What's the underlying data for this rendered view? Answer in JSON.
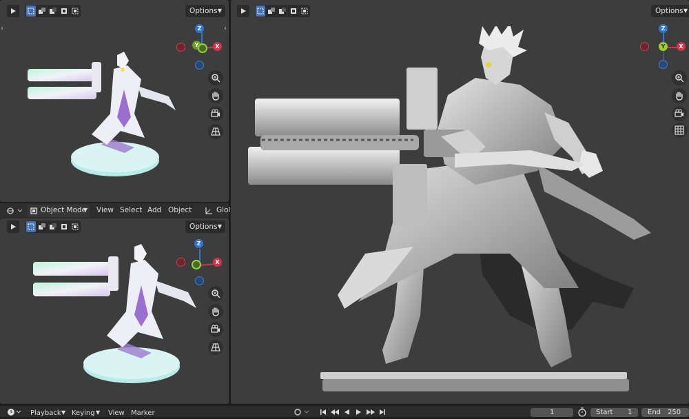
{
  "colors": {
    "viewport_bg": "#3d3d3d",
    "header_button_bg": "#2b2b2b",
    "selected_blue": "#4772b3",
    "axis_x": "#d7344b",
    "axis_y": "#6aa01c",
    "axis_z": "#2e75d3"
  },
  "viewports": {
    "top_left": {
      "options_label": "Options"
    },
    "bottom_left": {
      "options_label": "Options"
    },
    "main": {
      "options_label": "Options"
    }
  },
  "gizmo": {
    "x_label": "X",
    "y_label": "Y",
    "z_label": "Z"
  },
  "icons": {
    "tool": "select-cursor-icon",
    "select_modes": [
      "select-box-icon",
      "select-extend-icon",
      "select-subtract-icon",
      "select-invert-icon",
      "select-intersect-icon"
    ],
    "nav": [
      "zoom-icon",
      "hand-pan-icon",
      "camera-icon",
      "ortho-grid-icon"
    ]
  },
  "toolbar": {
    "mode_label": "Object Mode",
    "menu_view": "View",
    "menu_select": "Select",
    "menu_add": "Add",
    "menu_object": "Object",
    "transform_label": "Glol"
  },
  "timeline": {
    "playback_label": "Playback",
    "keying_label": "Keying",
    "view_label": "View",
    "marker_label": "Marker",
    "current_frame": "1",
    "start_label": "Start",
    "start_value": "1",
    "end_label": "End",
    "end_value": "250"
  }
}
